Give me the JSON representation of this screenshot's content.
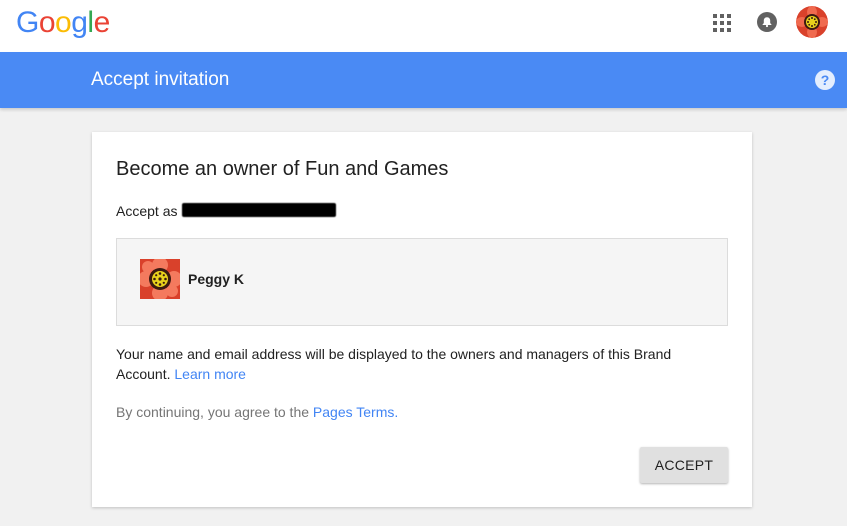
{
  "header": {
    "logo_letters": [
      "G",
      "o",
      "o",
      "g",
      "l",
      "e"
    ],
    "logo_colors": [
      "#4285f4",
      "#ea4335",
      "#fbbc05",
      "#4285f4",
      "#34a853",
      "#ea4335"
    ],
    "icons": [
      "apps-grid-icon",
      "notifications-bell-icon",
      "account-avatar"
    ]
  },
  "bluebar": {
    "title": "Accept invitation",
    "help_icon": "help-icon",
    "color": "#4a8af4"
  },
  "card": {
    "title": "Become an owner of Fun and Games",
    "accept_as_label": "Accept as",
    "account": {
      "name": "Peggy K"
    },
    "info_text": "Your name and email address will be displayed to the owners and managers of this Brand Account.",
    "learn_more": "Learn more",
    "terms_prefix": "By continuing, you agree to the",
    "terms_link": "Pages Terms",
    "terms_suffix": ".",
    "accept_button": "ACCEPT"
  },
  "colors": {
    "link": "#4285f4",
    "background": "#f1f1f1"
  }
}
